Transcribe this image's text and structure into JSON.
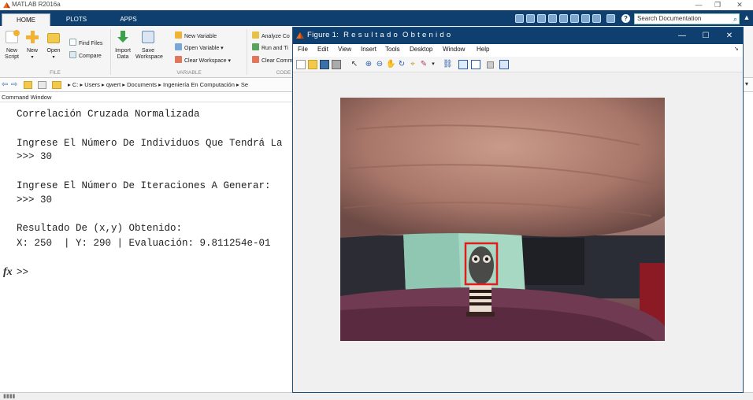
{
  "window": {
    "title": "MATLAB R2016a",
    "minimize_glyph": "—",
    "restore_glyph": "❐",
    "close_glyph": "✕"
  },
  "tabs": [
    {
      "label": "HOME",
      "active": true
    },
    {
      "label": "PLOTS",
      "active": false
    },
    {
      "label": "APPS",
      "active": false
    }
  ],
  "search": {
    "placeholder": "Search Documentation"
  },
  "ribbon": {
    "file": {
      "new_script": "New\nScript",
      "new": "New",
      "open": "Open",
      "find_files": "Find Files",
      "compare": "Compare",
      "section_label": "FILE"
    },
    "variable": {
      "import_data": "Import\nData",
      "save_workspace": "Save\nWorkspace",
      "new_variable": "New Variable",
      "open_variable": "Open Variable ▾",
      "clear_workspace": "Clear Workspace ▾",
      "section_label": "VARIABLE"
    },
    "code": {
      "analyze_code": "Analyze Co",
      "run_and_time": "Run and Ti",
      "clear_commands": "Clear Comm",
      "section_label": "CODE"
    }
  },
  "address": {
    "path": [
      "C:",
      "Users",
      "qwert",
      "Documents",
      "Ingeniería En Computación",
      "Se"
    ]
  },
  "command_window": {
    "header": "Command Window",
    "lines": [
      "Correlación Cruzada Normalizada",
      "",
      "Ingrese El Número De Individuos Que Tendrá La",
      ">>> 30",
      "",
      "Ingrese El Número De Iteraciones A Generar:",
      ">>> 30",
      "",
      "Resultado De (x,y) Obtenido:",
      "X: 250  | Y: 290 | Evaluación: 9.811254e-01"
    ],
    "prompt": ">>",
    "fx_label": "fx"
  },
  "status_bar": {
    "text": "▮▮▮▮"
  },
  "figure": {
    "title": "Figure 1:  R e s u l t a d o  O b t e n i d o",
    "menu": [
      "File",
      "Edit",
      "View",
      "Insert",
      "Tools",
      "Desktop",
      "Window",
      "Help"
    ],
    "toolbar_icons": [
      "new-figure-icon",
      "open-file-icon",
      "save-icon",
      "print-icon",
      "pointer-icon",
      "zoom-in-icon",
      "zoom-out-icon",
      "pan-icon",
      "rotate-icon",
      "data-cursor-icon",
      "brush-icon",
      "link-icon",
      "colorbar-icon",
      "legend-icon",
      "hide-tools-icon",
      "show-tools-icon"
    ],
    "image": {
      "description_name": "webcam-result-image",
      "detection_box_color": "#e11d1d"
    }
  },
  "colors": {
    "title_bar_blue": "#0e3f6e",
    "ribbon_bg": "#f5f5f5"
  }
}
